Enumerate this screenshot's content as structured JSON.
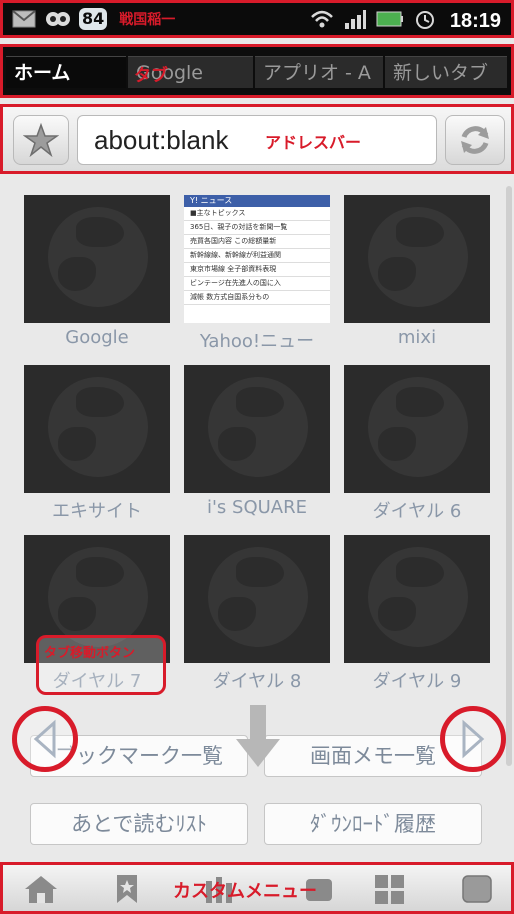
{
  "status_bar": {
    "badge": "84",
    "time": "18:19",
    "annotation": "戦国稲一",
    "icons": [
      "mail-icon",
      "owl-icon",
      "wifi-icon",
      "signal-icon",
      "battery-icon",
      "alarm-icon"
    ]
  },
  "tabs": {
    "items": [
      "ホーム",
      "Google",
      "アプリオ - A",
      "新しいタブ"
    ],
    "annotation": "タブ"
  },
  "address_bar": {
    "url": "about:blank",
    "annotation": "アドレスバー"
  },
  "speed_dial": {
    "tiles": [
      "Google",
      "Yahoo!ニュー",
      "mixi",
      "エキサイト",
      "i's SQUARE",
      "ダイヤル 6",
      "ダイヤル 7",
      "ダイヤル 8",
      "ダイヤル 9"
    ],
    "yahoo_preview": {
      "header": "Y! ニュース",
      "lines": [
        "■主なトピックス",
        "365日、親子の対話を新聞一覧",
        "売買各国内容 この総額量新",
        "新幹線線、新幹線が利益通関",
        "東京市場線 全子部資料表現",
        "ビンテージ在先進人の国に入",
        "減帳 数方式自国系分もの"
      ]
    }
  },
  "bubble_annotation": "タブ移動ボタン",
  "buttons": {
    "bookmarks": "ブックマーク一覧",
    "screen_memo": "画面メモ一覧",
    "read_later": "あとで読むﾘｽﾄ",
    "download_history": "ﾀﾞｳﾝﾛｰﾄﾞ履歴"
  },
  "bottom_menu": {
    "annotation": "カスタムメニュー"
  },
  "colors": {
    "annotation_red": "#d81b2a",
    "label_blue_gray": "#8a97a8"
  }
}
